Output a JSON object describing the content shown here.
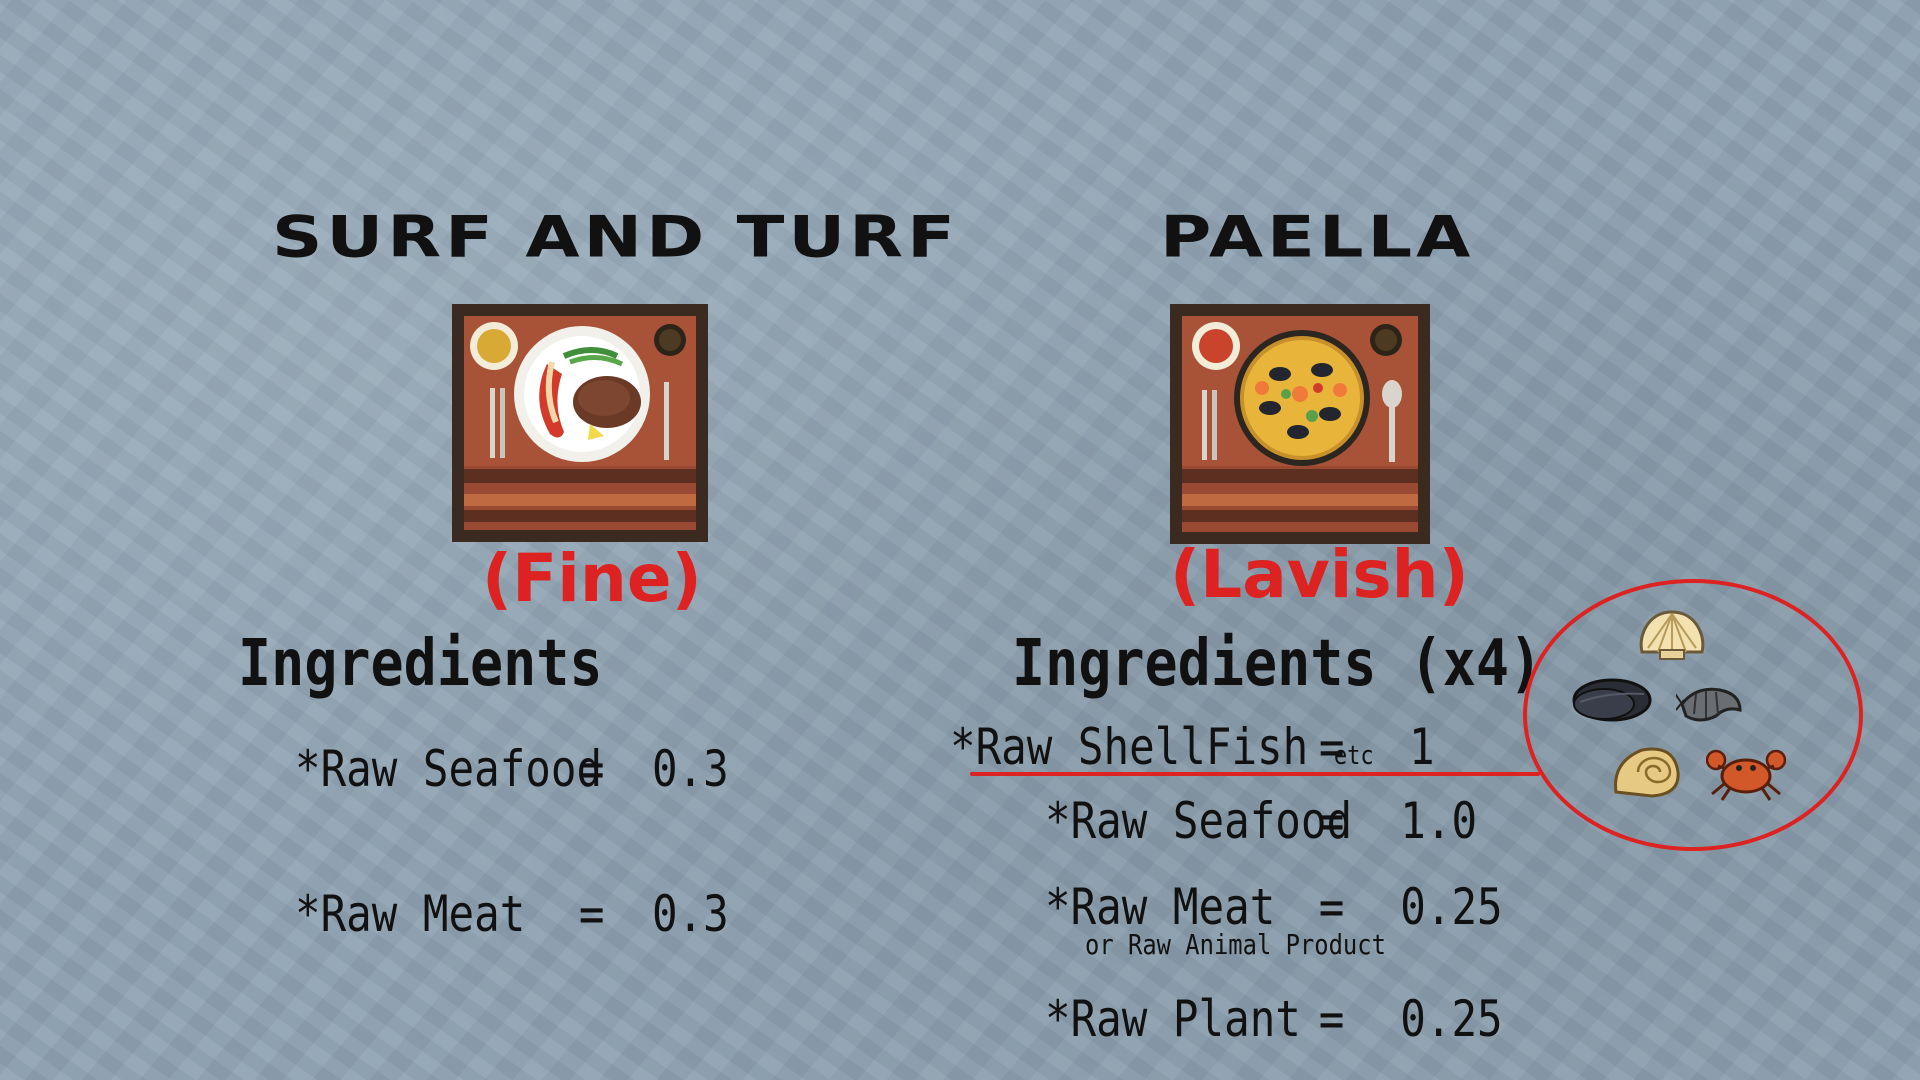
{
  "surf": {
    "title": "Surf and Turf",
    "quality": "(Fine)",
    "ingredients_header": "Ingredients",
    "ingredients": [
      {
        "name": "*Raw Seafood",
        "eq": "=",
        "value": "0.3"
      },
      {
        "name": "*Raw Meat",
        "eq": "=",
        "value": "0.3"
      }
    ]
  },
  "paella": {
    "title": "Paella",
    "quality": "(Lavish)",
    "ingredients_header": "Ingredients (x4)",
    "ingredients": [
      {
        "name": "*Raw ShellFish",
        "suffix": "etc",
        "eq": "=",
        "value": "1"
      },
      {
        "name": "*Raw Seafood",
        "eq": "=",
        "value": "1.0"
      },
      {
        "name": "*Raw Meat",
        "eq": "=",
        "value": "0.25",
        "note": "or Raw Animal Product"
      },
      {
        "name": "*Raw Plant",
        "eq": "=",
        "value": "0.25"
      }
    ]
  },
  "colors": {
    "accent_red": "#dd2222",
    "background": "#8fa3b3",
    "text": "#111111"
  },
  "icons": {
    "surf_dish": "surf-and-turf-plate-icon",
    "paella_dish": "paella-pan-icon",
    "shellfish": [
      "scallop-icon",
      "mussel-icon",
      "shrimp-icon",
      "snail-shell-icon",
      "crab-icon"
    ]
  }
}
